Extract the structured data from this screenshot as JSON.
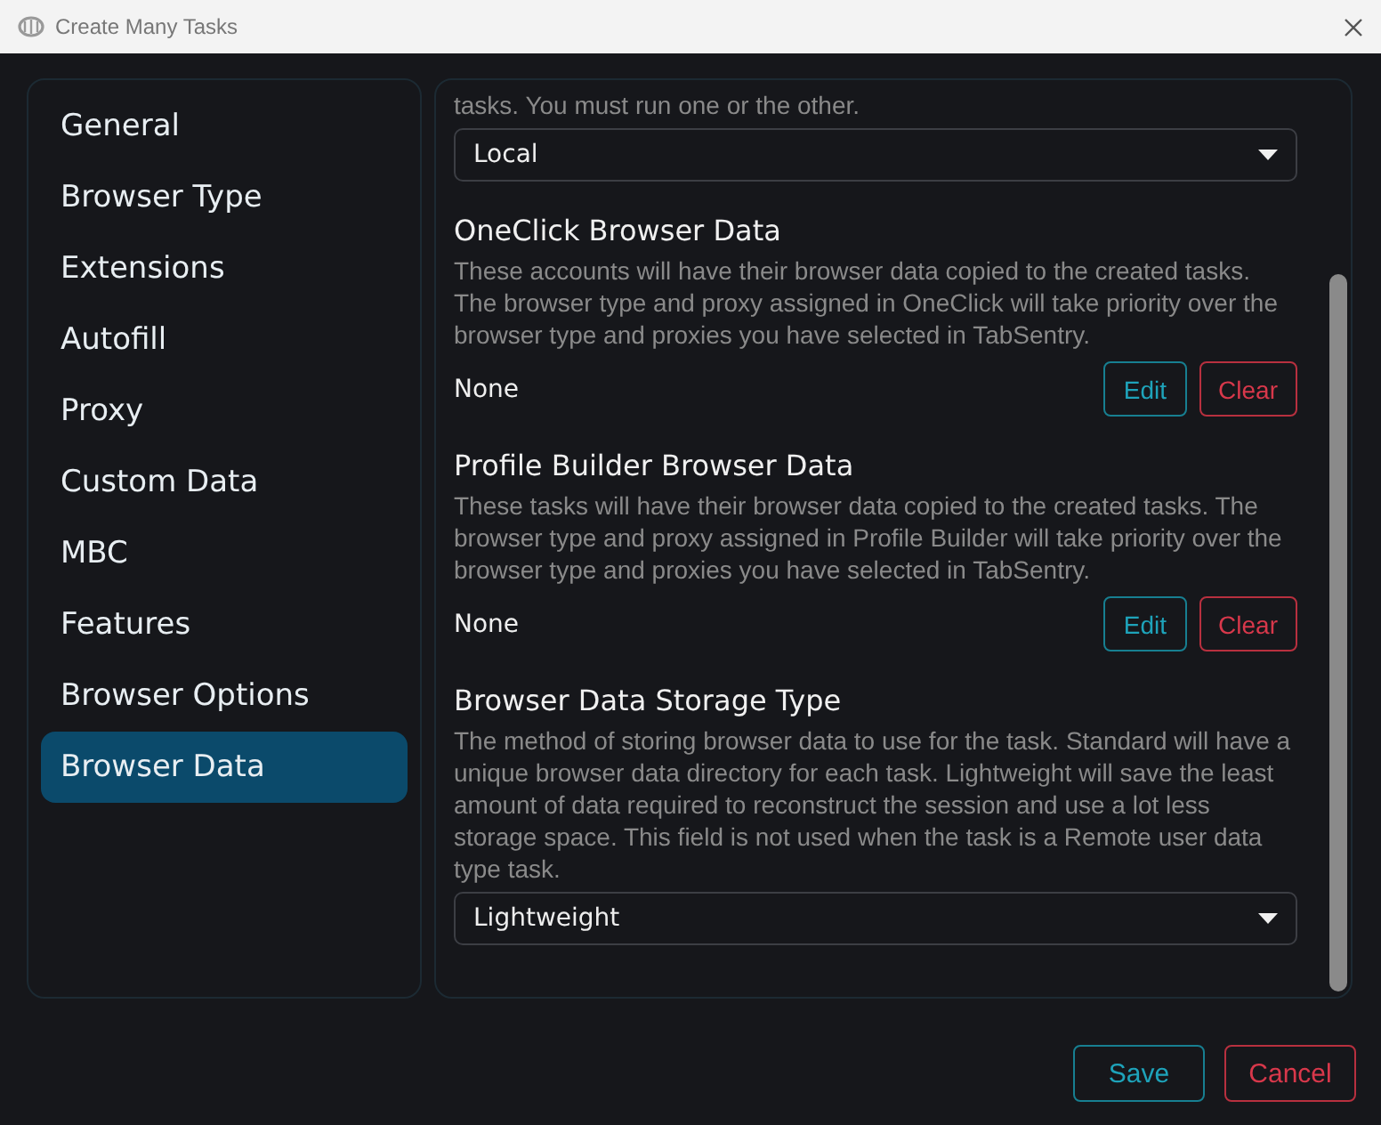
{
  "window": {
    "title": "Create Many Tasks"
  },
  "sidebar": {
    "items": [
      {
        "label": "General",
        "selected": false
      },
      {
        "label": "Browser Type",
        "selected": false
      },
      {
        "label": "Extensions",
        "selected": false
      },
      {
        "label": "Autofill",
        "selected": false
      },
      {
        "label": "Proxy",
        "selected": false
      },
      {
        "label": "Custom Data",
        "selected": false
      },
      {
        "label": "MBC",
        "selected": false
      },
      {
        "label": "Features",
        "selected": false
      },
      {
        "label": "Browser Options",
        "selected": false
      },
      {
        "label": "Browser Data",
        "selected": true
      }
    ]
  },
  "panel": {
    "sections": [
      {
        "kind": "select",
        "description": "tasks. You must run one or the other.",
        "value": "Local"
      },
      {
        "kind": "picker",
        "title": "OneClick Browser Data",
        "description": "These accounts will have their browser data copied to the created tasks. The browser type and proxy assigned in OneClick will take priority over the browser type and proxies you have selected in TabSentry.",
        "value": "None",
        "buttons": [
          {
            "label": "Edit",
            "kind": "edit"
          },
          {
            "label": "Clear",
            "kind": "clear"
          }
        ]
      },
      {
        "kind": "picker",
        "title": "Profile Builder Browser Data",
        "description": "These tasks will have their browser data copied to the created tasks. The browser type and proxy assigned in Profile Builder will take priority over the browser type and proxies you have selected in TabSentry.",
        "value": "None",
        "buttons": [
          {
            "label": "Edit",
            "kind": "edit"
          },
          {
            "label": "Clear",
            "kind": "clear"
          }
        ]
      },
      {
        "kind": "select",
        "title": "Browser Data Storage Type",
        "description": "The method of storing browser data to use for the task. Standard will have a unique browser data directory for each task. Lightweight will save the least amount of data required to reconstruct the session and use a lot less storage space. This field is not used when the task is a Remote user data type task.",
        "value": "Lightweight"
      }
    ]
  },
  "footer": {
    "buttons": [
      {
        "label": "Save",
        "kind": "edit"
      },
      {
        "label": "Cancel",
        "kind": "clear"
      }
    ]
  }
}
